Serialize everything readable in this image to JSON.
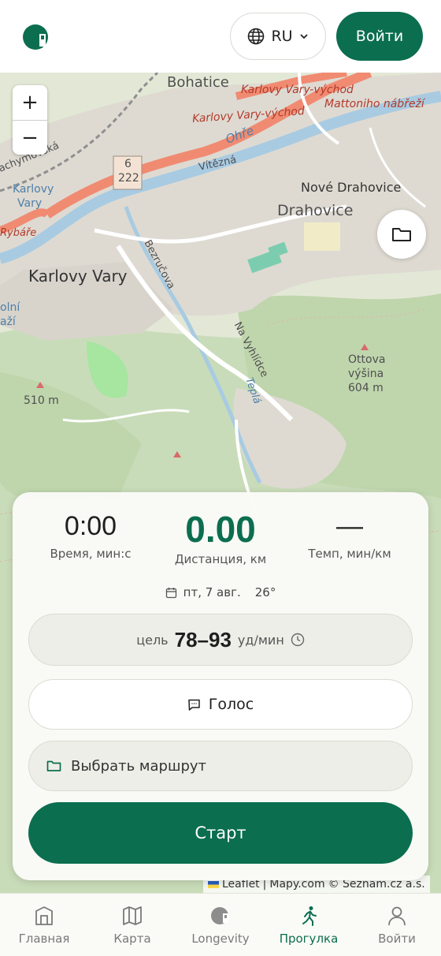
{
  "header": {
    "language": "RU",
    "login_label": "Войти",
    "icons": {
      "logo": "app-logo",
      "language": "globe-icon",
      "dropdown": "chevron-down-icon"
    }
  },
  "map": {
    "labels": {
      "bohatice": "Bohatice",
      "kv_vychod_1": "Karlovy Vary-východ",
      "kv_vychod_2": "Karlovy Vary-východ",
      "mattoniho": "Mattoniho nábřeží",
      "ohre": "Ohře",
      "vitezna": "Vítězná",
      "road_6": "6",
      "road_222": "222",
      "chyn": "achymovská",
      "karlovy_vary_small": "Karlovy",
      "vary_small": "Vary",
      "rybare": "Rybáře",
      "nove_drahovice": "Nové Drahovice",
      "drahovice": "Drahovice",
      "bezrucova": "Bezručova",
      "karlovy_vary": "Karlovy Vary",
      "olni": "olní",
      "azi": "aží",
      "na_vyhlidce": "Na Vyhlídce",
      "tepla": "Teplá",
      "ottova_1": "Ottova",
      "ottova_2": "výšina",
      "ottova_3": "604 m",
      "m510": "510 m"
    },
    "zoom_in": "+",
    "zoom_out": "−",
    "attribution": {
      "leaflet": "Leaflet",
      "separator": "|",
      "mapy": "Mapy.com",
      "copyright": "© Seznam.cz a.s."
    }
  },
  "session": {
    "time_value": "0:00",
    "time_label": "Время, мин:с",
    "distance_value": "0.00",
    "distance_label": "Дистанция, км",
    "pace_value": "—",
    "pace_label": "Темп, мин/км",
    "date": "пт, 7 авг.",
    "temperature": "26°",
    "target_prefix": "цель",
    "target_range": "78–93",
    "target_unit": "уд/мин",
    "voice_label": "Голос",
    "route_label": "Выбрать маршрут",
    "start_label": "Старт"
  },
  "nav": {
    "items": [
      {
        "label": "Главная",
        "icon": "home-icon"
      },
      {
        "label": "Карта",
        "icon": "map-icon"
      },
      {
        "label": "Longevity",
        "icon": "longevity-icon"
      },
      {
        "label": "Прогулка",
        "icon": "walk-icon"
      },
      {
        "label": "Войти",
        "icon": "user-icon"
      }
    ],
    "active": "Прогулка"
  },
  "colors": {
    "brand": "#0b6e4f",
    "panel": "#fafaf7",
    "map_background": "#e9ecdf"
  }
}
